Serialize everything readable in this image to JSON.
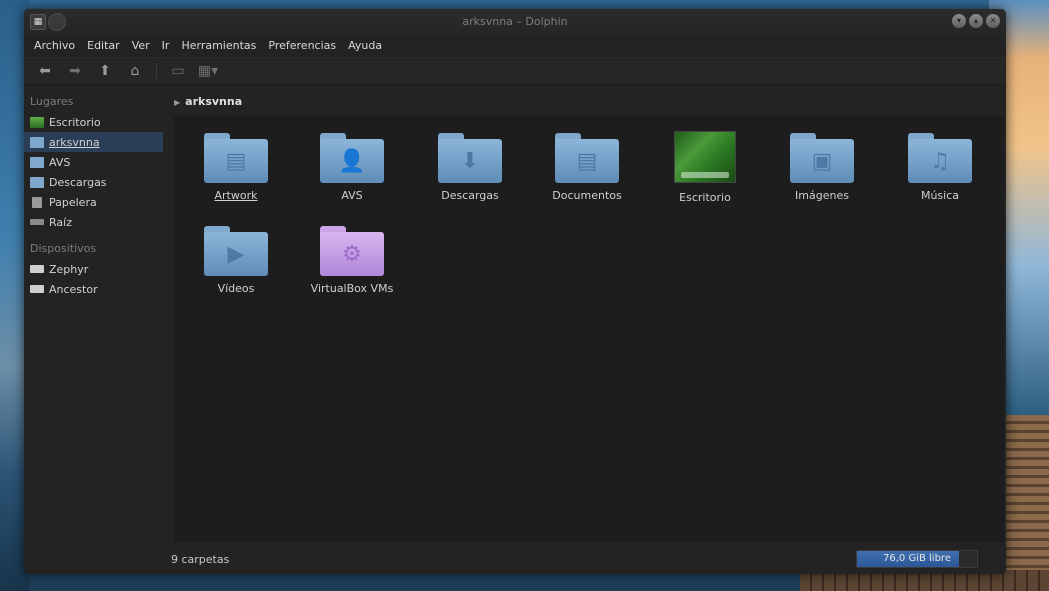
{
  "window": {
    "title": "arksvnna – Dolphin"
  },
  "menu": [
    "Archivo",
    "Editar",
    "Ver",
    "Ir",
    "Herramientas",
    "Preferencias",
    "Ayuda"
  ],
  "toolbar": {
    "back_icon": "arrow-left-icon",
    "forward_icon": "arrow-right-icon",
    "up_icon": "arrow-up-icon",
    "home_icon": "home-icon",
    "preview_icon": "preview-icon",
    "view_mode_icon": "view-mode-icon"
  },
  "sidebar": {
    "places_title": "Lugares",
    "places": [
      {
        "label": "Escritorio",
        "icon": "desktop-icon"
      },
      {
        "label": "arksvnna",
        "icon": "home-folder-icon",
        "selected": true
      },
      {
        "label": "AVS",
        "icon": "folder-icon"
      },
      {
        "label": "Descargas",
        "icon": "downloads-folder-icon"
      },
      {
        "label": "Papelera",
        "icon": "trash-icon"
      },
      {
        "label": "Raíz",
        "icon": "drive-icon"
      }
    ],
    "devices_title": "Dispositivos",
    "devices": [
      {
        "label": "Zephyr",
        "icon": "hard-drive-icon"
      },
      {
        "label": "Ancestor",
        "icon": "hard-drive-icon"
      }
    ]
  },
  "breadcrumb": {
    "current": "arksvnna"
  },
  "items": [
    {
      "label": "Artwork",
      "icon": "document-folder-icon",
      "glyph": "▤",
      "color": "blue"
    },
    {
      "label": "AVS",
      "icon": "user-folder-icon",
      "glyph": "👤",
      "color": "blue"
    },
    {
      "label": "Descargas",
      "icon": "downloads-folder-icon",
      "glyph": "⬇",
      "color": "blue"
    },
    {
      "label": "Documentos",
      "icon": "document-folder-icon",
      "glyph": "▤",
      "color": "blue"
    },
    {
      "label": "Escritorio",
      "icon": "desktop-folder-icon",
      "glyph": "",
      "color": "thumb"
    },
    {
      "label": "Imágenes",
      "icon": "pictures-folder-icon",
      "glyph": "▣",
      "color": "blue"
    },
    {
      "label": "Música",
      "icon": "music-folder-icon",
      "glyph": "♫",
      "color": "blue"
    },
    {
      "label": "Vídeos",
      "icon": "videos-folder-icon",
      "glyph": "▶",
      "color": "blue"
    },
    {
      "label": "VirtualBox VMs",
      "icon": "settings-folder-icon",
      "glyph": "⚙",
      "color": "purple"
    }
  ],
  "status": {
    "count_text": "9 carpetas",
    "free_space_text": "76,0 GiB libre",
    "free_fraction": 0.85
  }
}
